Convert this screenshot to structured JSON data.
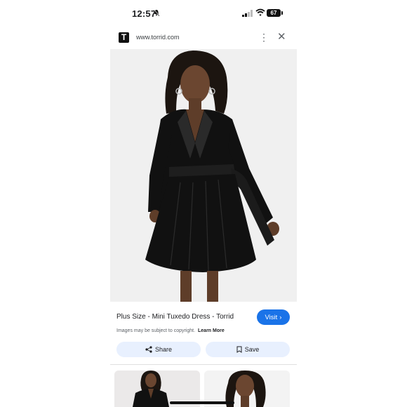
{
  "status_bar": {
    "time": "12:57",
    "battery_level": "67",
    "icons": [
      "bell-muted-icon",
      "signal-icon",
      "wifi-icon",
      "battery-icon"
    ]
  },
  "browser": {
    "favicon_letter": "T",
    "url": "www.torrid.com",
    "menu_icon": "more-vert-icon",
    "close_icon": "close-icon"
  },
  "result": {
    "title": "Plus Size - Mini Tuxedo Dress - Torrid",
    "visit_label": "Visit",
    "copyright_text": "Images may be subject to copyright.",
    "learn_more": "Learn More"
  },
  "actions": {
    "share_label": "Share",
    "save_label": "Save"
  },
  "colors": {
    "accent": "#1a73e8",
    "chip_background": "#e8f0fe",
    "dress": "#111111"
  }
}
